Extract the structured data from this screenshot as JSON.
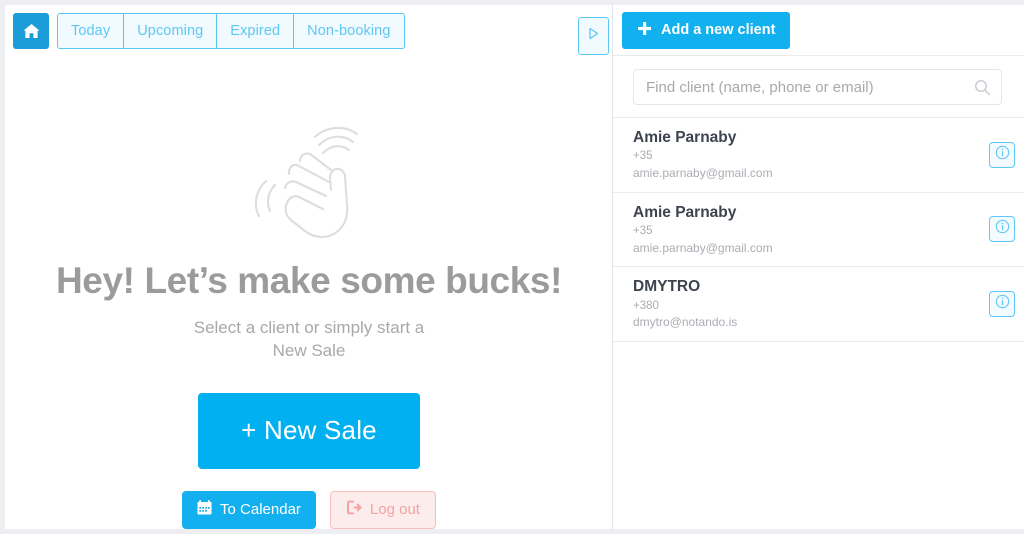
{
  "toolbar": {
    "home_icon": "home-icon",
    "tabs": [
      {
        "label": "Today"
      },
      {
        "label": "Upcoming"
      },
      {
        "label": "Expired"
      },
      {
        "label": "Non-booking"
      }
    ],
    "play_icon": "play-triangle-icon"
  },
  "hero": {
    "icon": "waving-hand-icon",
    "title": "Hey! Let’s make some bucks!",
    "subtitle": "Select a client or simply start a\nNew Sale",
    "new_sale_label": "+ New Sale",
    "calendar_label": "To Calendar",
    "calendar_icon": "calendar-icon",
    "logout_label": "Log out",
    "logout_icon": "logout-icon"
  },
  "clients_panel": {
    "add_client_label": "Add a new client",
    "add_client_icon": "plus-icon",
    "search": {
      "placeholder": "Find client (name, phone or email)",
      "value": "",
      "icon": "search-icon"
    },
    "rows": [
      {
        "name": "Amie Parnaby",
        "phone": "+35",
        "email": "amie.parnaby@gmail.com",
        "info_icon": "info-circle-icon"
      },
      {
        "name": "Amie Parnaby",
        "phone": "+35",
        "email": "amie.parnaby@gmail.com",
        "info_icon": "info-circle-icon"
      },
      {
        "name": "DMYTRO",
        "phone": "+380",
        "email": "dmytro@notando.is",
        "info_icon": "info-circle-icon"
      }
    ]
  },
  "colors": {
    "primary_blue": "#00b0f0",
    "home_blue": "#1b9dd9",
    "light_blue": "#5ec8f2",
    "tab_bg": "#f0faff",
    "danger_pink": "#f2a3a3",
    "danger_bg": "#fdecec",
    "text_gray": "#9b9b9b",
    "muted_gray": "#a9adb2"
  }
}
